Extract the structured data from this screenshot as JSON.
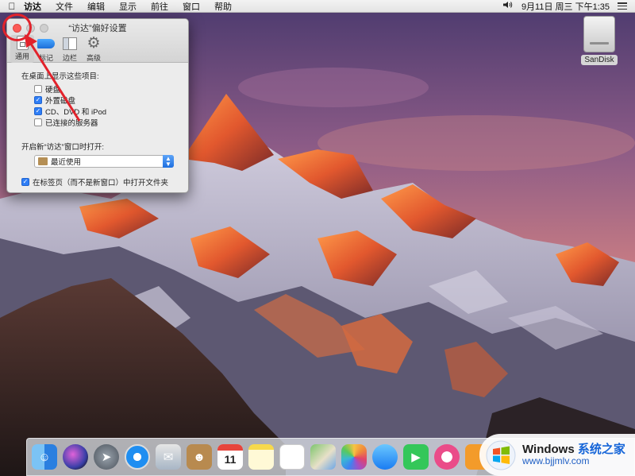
{
  "menubar": {
    "apple_icon": "apple-logo-icon",
    "items": [
      "访达",
      "文件",
      "编辑",
      "显示",
      "前往",
      "窗口",
      "帮助"
    ],
    "status_icons": [
      "volume-icon",
      "list-icon"
    ],
    "clock": "9月11日 周三 下午1:35"
  },
  "desktop": {
    "drive_label": "SanDisk"
  },
  "prefs_window": {
    "title": "“访达”偏好设置",
    "toolbar": [
      {
        "label": "通用",
        "icon": "general-icon",
        "active": true
      },
      {
        "label": "标记",
        "icon": "tags-icon",
        "active": false
      },
      {
        "label": "边栏",
        "icon": "sidebar-icon",
        "active": false
      },
      {
        "label": "高级",
        "icon": "gear-icon",
        "active": false
      }
    ],
    "desktop_section_label": "在桌面上显示这些项目:",
    "desktop_items": [
      {
        "label": "硬盘",
        "checked": false
      },
      {
        "label": "外置磁盘",
        "checked": true
      },
      {
        "label": "CD、DVD 和 iPod",
        "checked": true
      },
      {
        "label": "已连接的服务器",
        "checked": false
      }
    ],
    "new_window_label": "开启新“访达”窗口时打开:",
    "new_window_value": "最近使用",
    "open_in_tabs_label": "在标签页（而不是新窗口）中打开文件夹",
    "open_in_tabs_checked": true
  },
  "dock": {
    "apps": [
      {
        "name": "finder",
        "icon": "finder-icon"
      },
      {
        "name": "siri",
        "icon": "siri-icon"
      },
      {
        "name": "launchpad",
        "icon": "rocket-icon"
      },
      {
        "name": "safari",
        "icon": "compass-icon"
      },
      {
        "name": "mail",
        "icon": "stamp-icon"
      },
      {
        "name": "contacts",
        "icon": "contacts-icon"
      },
      {
        "name": "calendar",
        "icon": "calendar-icon",
        "text": "11"
      },
      {
        "name": "notes",
        "icon": "notes-icon"
      },
      {
        "name": "reminders",
        "icon": "reminders-icon"
      },
      {
        "name": "maps",
        "icon": "map-icon"
      },
      {
        "name": "photos",
        "icon": "photos-icon"
      },
      {
        "name": "messages",
        "icon": "messages-icon"
      },
      {
        "name": "facetime",
        "icon": "facetime-icon"
      },
      {
        "name": "itunes",
        "icon": "music-icon"
      },
      {
        "name": "ibooks",
        "icon": "books-icon"
      }
    ]
  },
  "watermark": {
    "title_main": "Windows",
    "title_accent": "系统之家",
    "url": "www.bjjmlv.com"
  },
  "colors": {
    "accent_blue": "#2f7ef6",
    "close_red": "#fc5b57",
    "annotation_red": "#e2222b"
  }
}
